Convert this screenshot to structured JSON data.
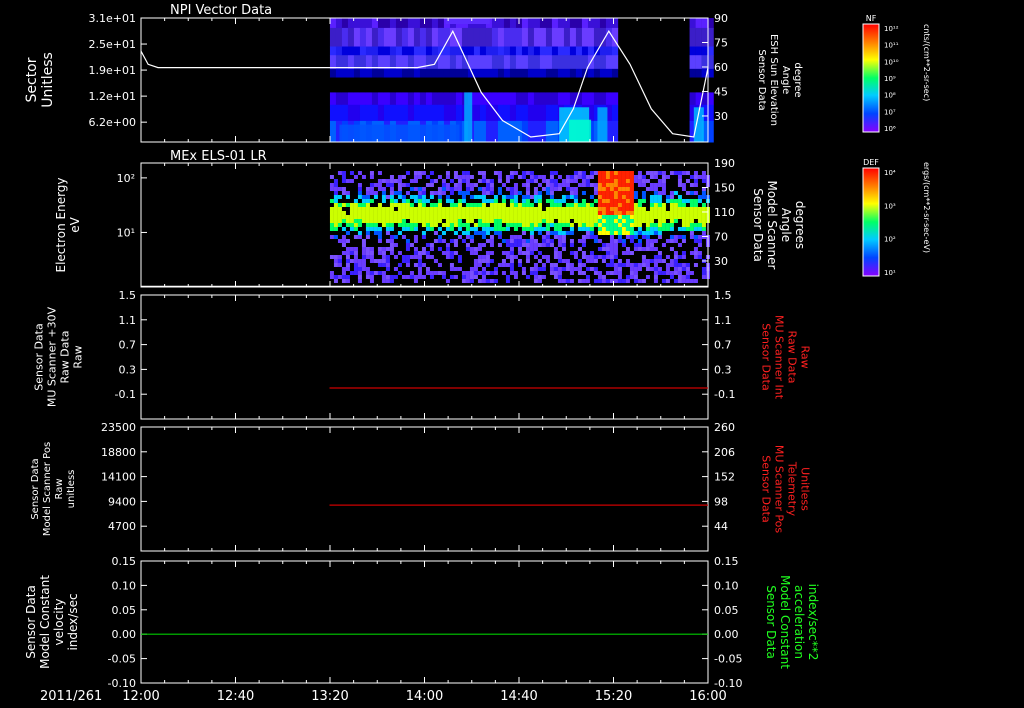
{
  "panels_title": {
    "top": "NPI Vector Data",
    "second": "MEx ELS-01 LR"
  },
  "time_axis": {
    "date_label": "2011/261",
    "ticks": [
      "12:00",
      "12:40",
      "13:20",
      "14:00",
      "14:40",
      "15:20",
      "16:00"
    ]
  },
  "colorbars": {
    "top": {
      "tag": "NF",
      "unit": "cnts/(cm**2-sr-sec)",
      "tick_labels": [
        "10¹²",
        "10¹¹",
        "10¹⁰",
        "10⁹",
        "10⁸",
        "10⁷",
        "10⁶"
      ]
    },
    "second": {
      "tag": "DEF",
      "unit": "ergs/(cm**2-sr-sec-eV)",
      "tick_labels": [
        "10⁴",
        "10³",
        "10²",
        "10¹"
      ]
    }
  },
  "colors": {
    "axis": "#ffffff",
    "red_trace": "#cc0000",
    "green_trace": "#00cc00",
    "white_trace": "#ffffff",
    "label_red": "#ff2020",
    "label_green": "#20ff20"
  },
  "chart_data": [
    {
      "type": "heatmap",
      "title": "NPI Vector Data",
      "ylabel_left": [
        "Sector",
        "Unitless"
      ],
      "ytick_left": [
        "3.1e+01",
        "2.5e+01",
        "1.9e+01",
        "1.2e+01",
        "6.2e+00"
      ],
      "ylabel_right": [
        "Sensor Data",
        "ESH Sun Elevation",
        "Angle",
        "degree"
      ],
      "ytick_right": [
        "90",
        "75",
        "60",
        "45",
        "30"
      ],
      "data_interval_hours": [
        13.33,
        15.33,
        16.0
      ],
      "overlay_series": {
        "name": "ESH Sun Elevation Angle",
        "axis": "right",
        "ylim": [
          15,
          90
        ],
        "x_hours": [
          12.0,
          12.05,
          12.12,
          13.0,
          13.5,
          13.95,
          14.07,
          14.2,
          14.4,
          14.55,
          14.75,
          14.95,
          15.05,
          15.15,
          15.3,
          15.45,
          15.6,
          15.75,
          15.9,
          16.0
        ],
        "values": [
          70,
          62,
          60,
          60,
          60,
          60,
          62,
          82,
          45,
          28,
          18,
          20,
          35,
          60,
          82,
          62,
          35,
          20,
          18,
          60
        ]
      }
    },
    {
      "type": "heatmap",
      "title": "MEx ELS-01 LR",
      "ylabel_left": [
        "Electron Energy",
        "eV"
      ],
      "ytick_left": [
        "10²",
        "10¹"
      ],
      "ylabel_right": [
        "Sensor Data",
        "Model Scanner",
        "Angle",
        "degrees"
      ],
      "ytick_right": [
        "190",
        "150",
        "110",
        "70",
        "30"
      ],
      "data_interval_hours": [
        13.33,
        16.0
      ],
      "overlay_series": {
        "name": "Model Scanner Angle",
        "axis": "right",
        "ylim": [
          10,
          190
        ],
        "x_hours": [
          12.0,
          16.0
        ],
        "values": [
          11,
          11
        ]
      }
    },
    {
      "type": "line",
      "ylabel_left": [
        "Sensor Data",
        "MU Scanner +30V",
        "Raw Data",
        "Raw"
      ],
      "ytick_left": [
        "1.5",
        "1.1",
        "0.7",
        "0.3",
        "-0.1"
      ],
      "ylim_left": [
        -0.5,
        1.5
      ],
      "ylabel_right": [
        "Sensor Data",
        "MU Scanner Int",
        "Raw Data",
        "Raw"
      ],
      "ytick_right": [
        "1.5",
        "1.1",
        "0.7",
        "0.3",
        "-0.1"
      ],
      "ylim_right": [
        -0.5,
        1.5
      ],
      "series": [
        {
          "name": "MU Scanner Int Raw Data",
          "axis": "right",
          "x_hours": [
            13.33,
            16.0
          ],
          "values": [
            0.0,
            0.0
          ]
        }
      ]
    },
    {
      "type": "line",
      "ylabel_left": [
        "Sensor Data",
        "Model Scanner Pos",
        "Raw",
        "unitless"
      ],
      "ytick_left": [
        "23500",
        "18800",
        "14100",
        "9400",
        "4700"
      ],
      "ylim_left": [
        0,
        23500
      ],
      "ylabel_right": [
        "Sensor Data",
        "MU Scanner Pos",
        "Telemetry",
        "Unitless"
      ],
      "ytick_right": [
        "260",
        "206",
        "152",
        "98",
        "44"
      ],
      "ylim_right": [
        -10,
        260
      ],
      "series": [
        {
          "name": "MU Scanner Pos Telemetry",
          "axis": "right",
          "x_hours": [
            13.33,
            16.0
          ],
          "values": [
            90,
            90
          ]
        }
      ]
    },
    {
      "type": "line",
      "ylabel_left": [
        "Sensor Data",
        "Model Constant",
        "velocity",
        "index/sec"
      ],
      "ytick_left": [
        "0.15",
        "0.10",
        "0.05",
        "0.00",
        "-0.05",
        "-0.10"
      ],
      "ylim_left": [
        -0.1,
        0.15
      ],
      "ylabel_right": [
        "Sensor Data",
        "Model Constant",
        "acceleration",
        "index/sec**2"
      ],
      "ytick_right": [
        "0.15",
        "0.10",
        "0.05",
        "0.00",
        "-0.05",
        "-0.10"
      ],
      "ylim_right": [
        -0.1,
        0.15
      ],
      "series": [
        {
          "name": "Model Constant acceleration",
          "axis": "right",
          "x_hours": [
            12.0,
            16.0
          ],
          "values": [
            0.0,
            0.0
          ]
        }
      ]
    }
  ]
}
